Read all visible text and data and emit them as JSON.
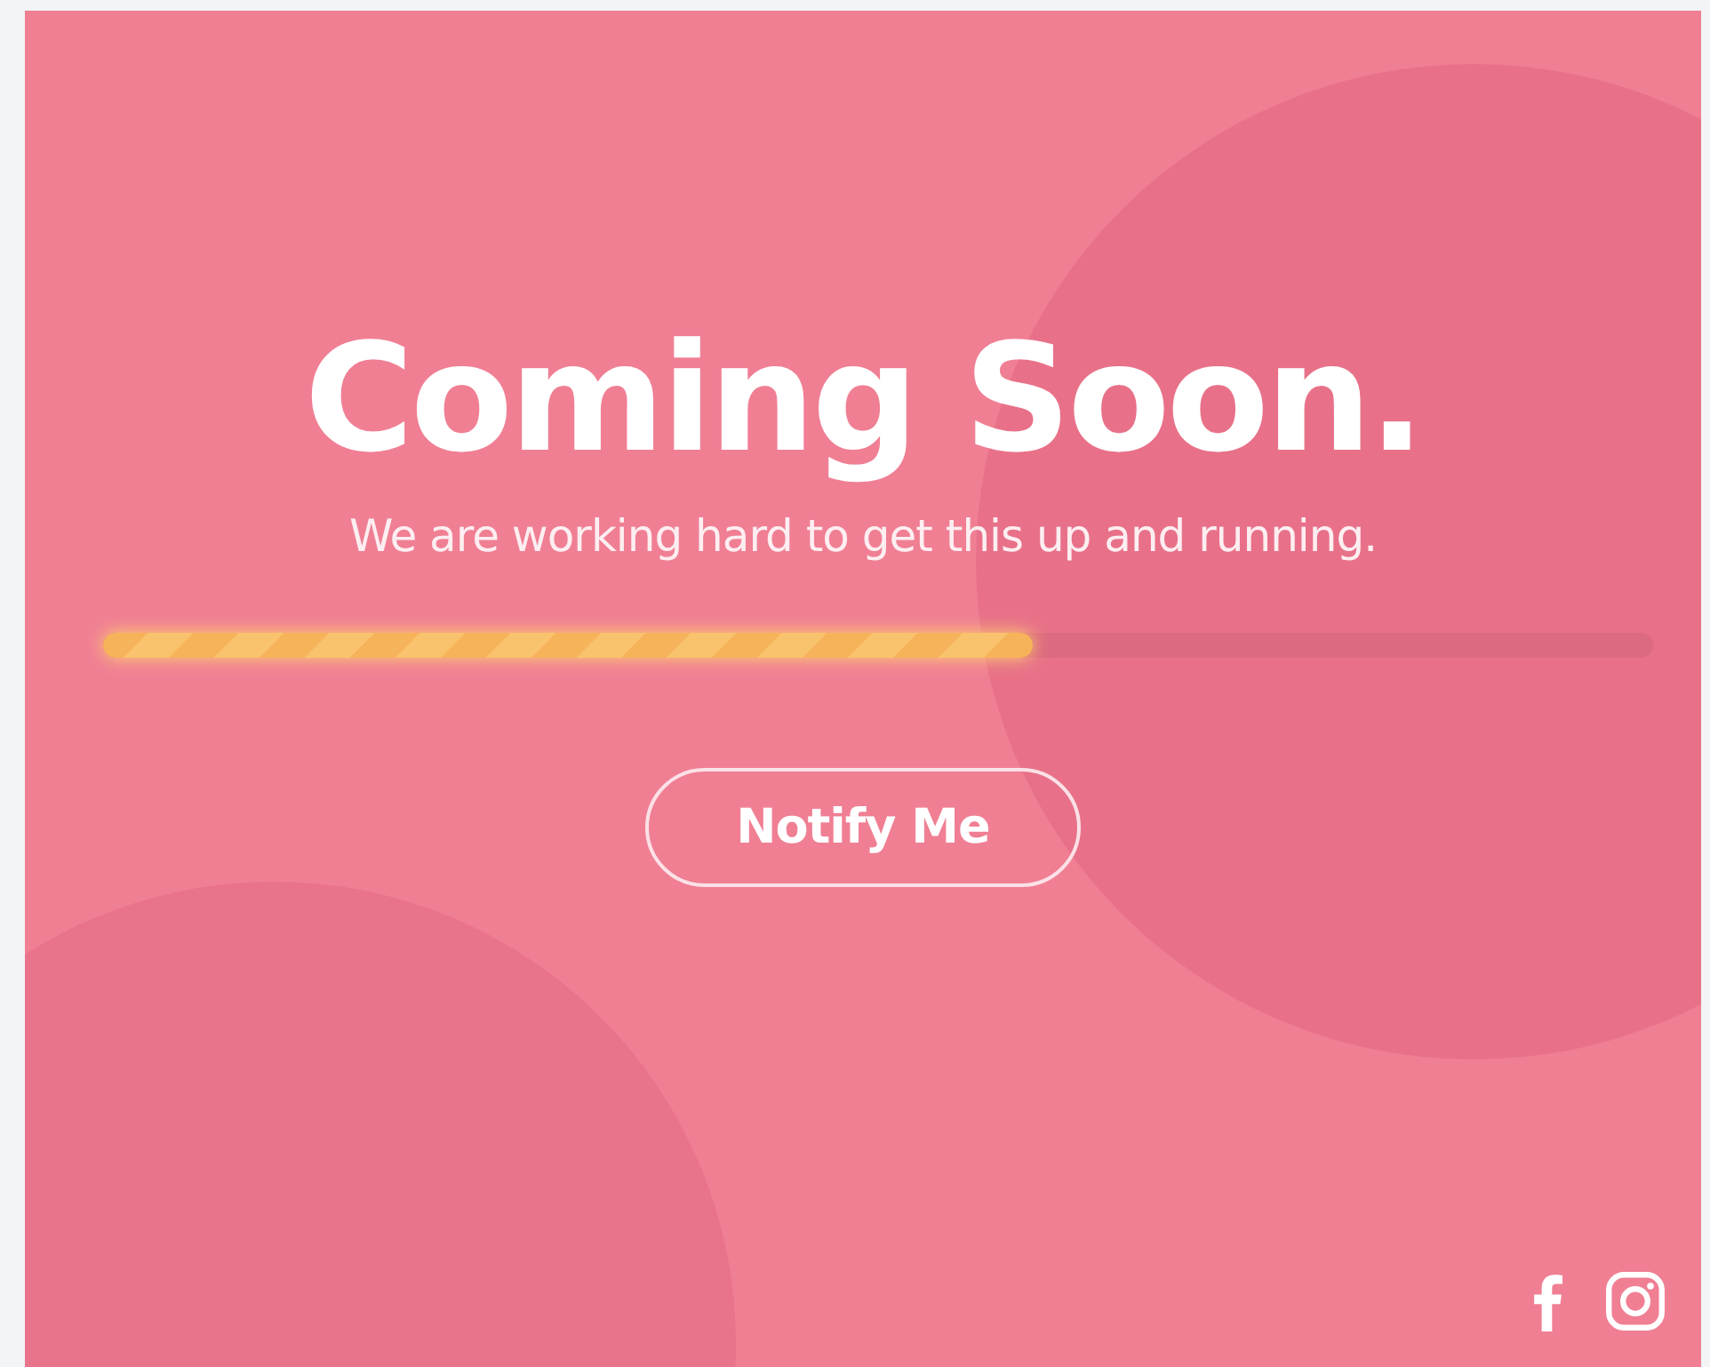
{
  "hero": {
    "title": "Coming Soon.",
    "subtitle": "We are working hard to get this up and running."
  },
  "progress": {
    "level": 0.6
  },
  "button": {
    "label": "Notify Me"
  },
  "social": [
    {
      "kind": "facebook"
    },
    {
      "kind": "instagram"
    }
  ]
}
